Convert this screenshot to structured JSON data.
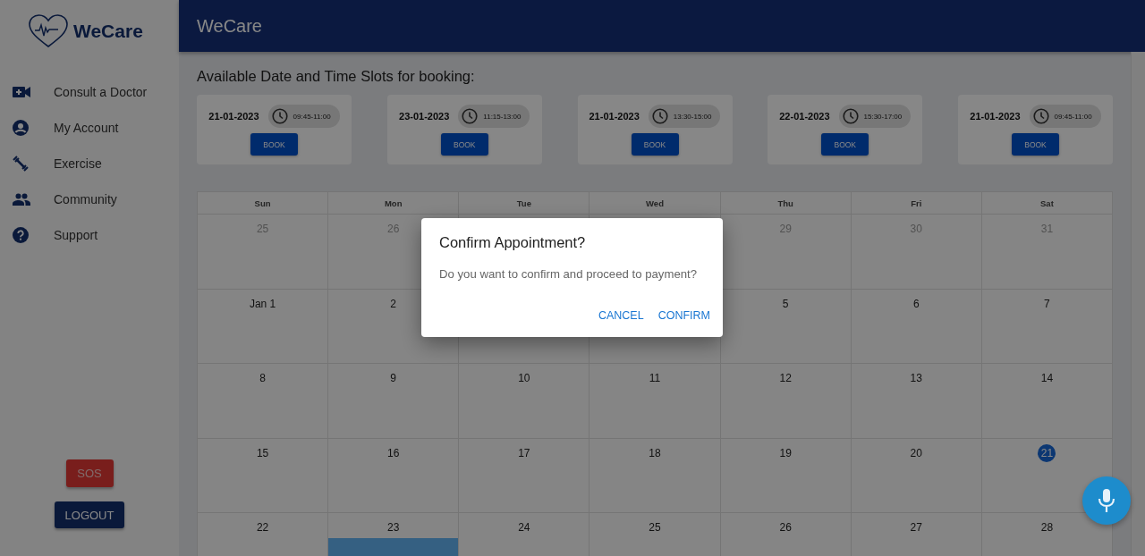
{
  "brand": {
    "name": "WeCare"
  },
  "header": {
    "title": "WeCare"
  },
  "sidebar": {
    "items": [
      {
        "label": "Consult a Doctor",
        "kind": "video"
      },
      {
        "label": "My Account",
        "kind": "account"
      },
      {
        "label": "Exercise",
        "kind": "dumbbell"
      },
      {
        "label": "Community",
        "kind": "people"
      },
      {
        "label": "Support",
        "kind": "help"
      }
    ],
    "sos_button": "SOS",
    "logout_button": "LOGOUT"
  },
  "slots": {
    "heading": "Available Date and Time Slots for booking:",
    "items": [
      {
        "date": "21-01-2023",
        "time": "09:45-11:00",
        "button": "BOOK"
      },
      {
        "date": "23-01-2023",
        "time": "11:15-13:00",
        "button": "BOOK"
      },
      {
        "date": "21-01-2023",
        "time": "13:30-15:00",
        "button": "BOOK"
      },
      {
        "date": "22-01-2023",
        "time": "15:30-17:00",
        "button": "BOOK"
      },
      {
        "date": "21-01-2023",
        "time": "09:45-11:00",
        "button": "BOOK"
      }
    ]
  },
  "calendar": {
    "weekdays": [
      "Sun",
      "Mon",
      "Tue",
      "Wed",
      "Thu",
      "Fri",
      "Sat"
    ],
    "weeks": [
      [
        {
          "kind": "day",
          "day": "25",
          "outside": true,
          "today": false,
          "event": false
        },
        {
          "kind": "day",
          "day": "26",
          "outside": true,
          "today": false,
          "event": false
        },
        {
          "kind": "covered"
        },
        {
          "kind": "covered"
        },
        {
          "kind": "day",
          "day": "29",
          "outside": true,
          "today": false,
          "event": false
        },
        {
          "kind": "day",
          "day": "30",
          "outside": true,
          "today": false,
          "event": false
        },
        {
          "kind": "day",
          "day": "31",
          "outside": true,
          "today": false,
          "event": false
        }
      ],
      [
        {
          "kind": "day",
          "day": "Jan 1",
          "outside": false,
          "today": false,
          "event": false
        },
        {
          "kind": "day",
          "day": "2",
          "outside": false,
          "today": false,
          "event": false
        },
        {
          "kind": "covered"
        },
        {
          "kind": "covered"
        },
        {
          "kind": "day",
          "day": "5",
          "outside": false,
          "today": false,
          "event": false
        },
        {
          "kind": "day",
          "day": "6",
          "outside": false,
          "today": false,
          "event": false
        },
        {
          "kind": "day",
          "day": "7",
          "outside": false,
          "today": false,
          "event": false
        }
      ],
      [
        {
          "kind": "day",
          "day": "8",
          "outside": false,
          "today": false,
          "event": false
        },
        {
          "kind": "day",
          "day": "9",
          "outside": false,
          "today": false,
          "event": false
        },
        {
          "kind": "day",
          "day": "10",
          "outside": false,
          "today": false,
          "event": false
        },
        {
          "kind": "day",
          "day": "11",
          "outside": false,
          "today": false,
          "event": false
        },
        {
          "kind": "day",
          "day": "12",
          "outside": false,
          "today": false,
          "event": false
        },
        {
          "kind": "day",
          "day": "13",
          "outside": false,
          "today": false,
          "event": false
        },
        {
          "kind": "day",
          "day": "14",
          "outside": false,
          "today": false,
          "event": false
        }
      ],
      [
        {
          "kind": "day",
          "day": "15",
          "outside": false,
          "today": false,
          "event": false
        },
        {
          "kind": "day",
          "day": "16",
          "outside": false,
          "today": false,
          "event": false
        },
        {
          "kind": "day",
          "day": "17",
          "outside": false,
          "today": false,
          "event": false
        },
        {
          "kind": "day",
          "day": "18",
          "outside": false,
          "today": false,
          "event": false
        },
        {
          "kind": "day",
          "day": "19",
          "outside": false,
          "today": false,
          "event": false
        },
        {
          "kind": "day",
          "day": "20",
          "outside": false,
          "today": false,
          "event": false
        },
        {
          "kind": "day",
          "day": "21",
          "outside": false,
          "today": true,
          "event": false
        }
      ],
      [
        {
          "kind": "day",
          "day": "22",
          "outside": false,
          "today": false,
          "event": false
        },
        {
          "kind": "day",
          "day": "23",
          "outside": false,
          "today": false,
          "event": true
        },
        {
          "kind": "day",
          "day": "24",
          "outside": false,
          "today": false,
          "event": false
        },
        {
          "kind": "day",
          "day": "25",
          "outside": false,
          "today": false,
          "event": false
        },
        {
          "kind": "day",
          "day": "26",
          "outside": false,
          "today": false,
          "event": false
        },
        {
          "kind": "day",
          "day": "27",
          "outside": false,
          "today": false,
          "event": false
        },
        {
          "kind": "day",
          "day": "28",
          "outside": false,
          "today": false,
          "event": false
        }
      ]
    ]
  },
  "dialog": {
    "title": "Confirm Appointment?",
    "message": "Do you want to confirm and proceed to payment?",
    "actions": [
      "CANCEL",
      "CONFIRM"
    ]
  }
}
